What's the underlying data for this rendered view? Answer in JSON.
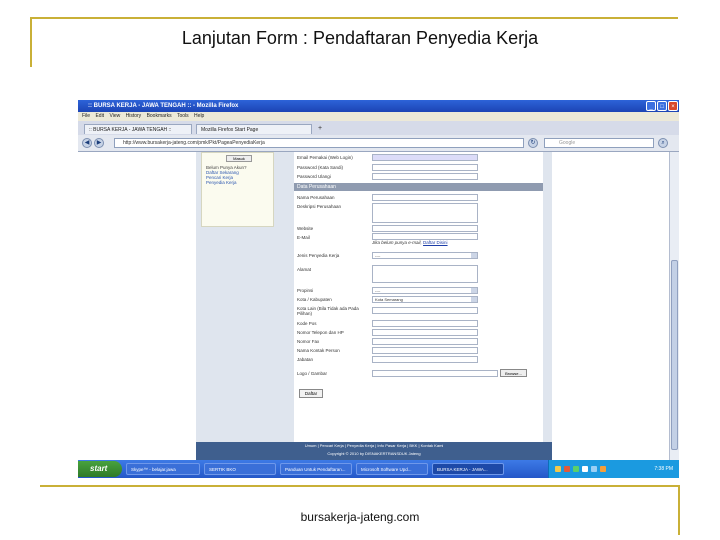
{
  "slide": {
    "title": "Lanjutan Form : Pendaftaran Penyedia Kerja",
    "footer": "bursakerja-jateng.com"
  },
  "browser": {
    "window_title": ":: BURSA KERJA - JAWA TENGAH :: - Mozilla Firefox",
    "menu": [
      "File",
      "Edit",
      "View",
      "History",
      "Bookmarks",
      "Tools",
      "Help"
    ],
    "tabs": [
      {
        "label": ":: BURSA KERJA - JAWA TENGAH ::"
      },
      {
        "label": "Mozilla Firefox Start Page"
      }
    ],
    "url": "http://www.bursakerja-jateng.com/pmk/Pkt/PageaPenyediaKerja",
    "search_placeholder": "Google"
  },
  "sidebar": {
    "button_label": "Masuk",
    "lines": [
      "Belum Punya Akun?",
      "Daftar Sekarang",
      "Pencari Kerja",
      "Penyedia Kerja"
    ]
  },
  "form": {
    "top_fields": [
      {
        "label": "Email Pemakai (Web Login)",
        "value": ""
      },
      {
        "label": "Password (Kata Sandi)",
        "value": ""
      },
      {
        "label": "Password Ulangi",
        "value": ""
      }
    ],
    "section_label": "Data Perusahaan",
    "company_name_label": "Nama Perusahaan",
    "company_desc_label": "Deskripsi Perusahaan",
    "website_label": "Website",
    "email_label": "E-Mail",
    "email_hint": "Jika belum punya e-mail,",
    "email_hint_link": "Daftar Disini",
    "jenis_label": "Jenis Penyedia Kerja",
    "jenis_value": "----",
    "alamat_label": "Alamat",
    "propinsi_label": "Propinsi",
    "propinsi_value": "----",
    "kota_label": "Kota / Kabupaten",
    "kota_value": "Kota Semarang",
    "kota_lain_label": "Kota Lain (Bila Tidak ada Pada Pilihan)",
    "rest_fields": [
      {
        "label": "Kode Pos"
      },
      {
        "label": "Nomor Telepon dan HP"
      },
      {
        "label": "Nomor Fax"
      },
      {
        "label": "Nama Kontak Person"
      },
      {
        "label": "Jabatan"
      }
    ],
    "logo_label": "Logo / Gambar",
    "browse_label": "Browse...",
    "submit_label": "Daftar"
  },
  "page_footer": {
    "links": "Umum  |  Pencari Kerja  |  Penyedia Kerja  |  Info Pasar Kerja  |  BKK  |  Kontak Kami",
    "copyright": "Copyright © 2010 by DISNAKERTRANSDUK Jateng"
  },
  "taskbar": {
    "start_label": "start",
    "buttons": [
      {
        "label": "Skype™ - belajar.jawa"
      },
      {
        "label": "SERTIK BKO"
      },
      {
        "label": "Panduan Untuk Pendaftaran..."
      },
      {
        "label": "Microsoft Software Upd..."
      },
      {
        "label": "BURSA KERJA - JAWA..."
      }
    ],
    "clock": "7:38 PM"
  }
}
